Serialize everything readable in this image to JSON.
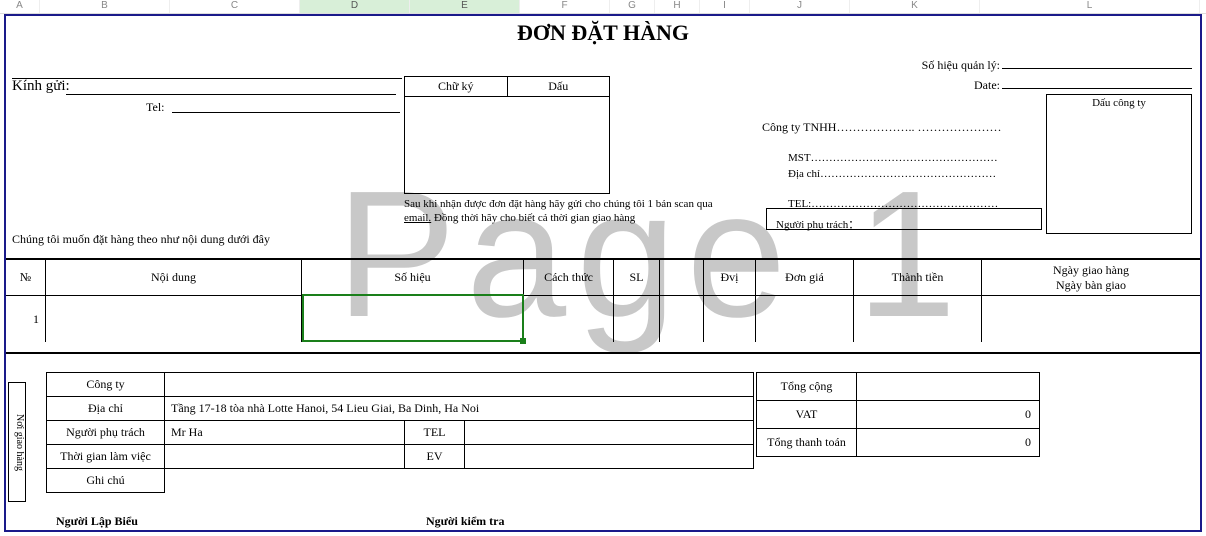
{
  "cols": [
    "A",
    "B",
    "C",
    "D",
    "E",
    "F",
    "G",
    "H",
    "I",
    "J",
    "K",
    "L"
  ],
  "watermark": "Page 1",
  "title": "ĐƠN ĐẶT HÀNG",
  "header": {
    "kinh_gui_label": "Kính gửi:",
    "tel_label": "Tel:",
    "so_hieu_ql_label": "Số hiệu quản lý:",
    "date_label": "Date:",
    "stamp_label": "Dấu công ty"
  },
  "sigbox": {
    "chuky": "Chữ ký",
    "dau": "Dấu"
  },
  "note_line1": "Sau khi nhận được đơn đặt hàng hãy gửi cho chúng tôi 1 bản scan qua",
  "note_email": "email.",
  "note_line2": " Đồng thời hãy cho biết cả thời gian giao hàng",
  "company": {
    "label": "Công ty TNHH",
    "dots": "……………….. …………………",
    "mst_label": "MST",
    "mst_dots": "……………………………………………",
    "diachi_label": "Địa chỉ",
    "diachi_dots": "…………………………………………",
    "tel_label": "TEL:",
    "tel_dots": "……………………………………………",
    "nguoi_pt_label": "Người phụ trách："
  },
  "order_note": "Chúng tôi muốn đặt hàng theo như nội dung dưới đây",
  "table": {
    "headers": {
      "no": "№",
      "noidung": "Nội dung",
      "sohieu": "Số hiệu",
      "cachthuc": "Cách thức",
      "sl": "SL",
      "dvi": "Đvị",
      "dongia": "Đơn giá",
      "thanhtien": "Thành tiền",
      "ngay1": "Ngày giao hàng",
      "ngay2": "Ngày bàn giao"
    },
    "rows": [
      {
        "no": "1",
        "noidung": "",
        "sohieu": "",
        "cachthuc": "",
        "sl": "",
        "sl2": "",
        "dvi": "",
        "dongia": "",
        "thanhtien": "",
        "ngay": ""
      }
    ]
  },
  "deliv": {
    "side_label": "Nơi giao hàng",
    "congty_label": "Công ty",
    "congty": "",
    "diachi_label": "Địa chỉ",
    "diachi": "Tầng 17-18 tòa nhà Lotte Hanoi, 54 Lieu Giai, Ba Dinh, Ha Noi",
    "nguoipt_label": "Người phụ trách",
    "nguoipt": "Mr Ha",
    "tel_label": "TEL",
    "tel": "",
    "tglv_label": "Thời gian làm việc",
    "tglv": "",
    "ev_label": "EV",
    "ev": "",
    "ghichu_label": "Ghi chú",
    "ghichu": ""
  },
  "totals": {
    "tongcong_label": "Tổng cộng",
    "tongcong": "",
    "vat_label": "VAT",
    "vat": "0",
    "tongtt_label": "Tổng thanh toán",
    "tongtt": "0"
  },
  "footer": {
    "lapbieu": "Người Lập Biểu",
    "kiemtra": "Người kiểm tra"
  }
}
